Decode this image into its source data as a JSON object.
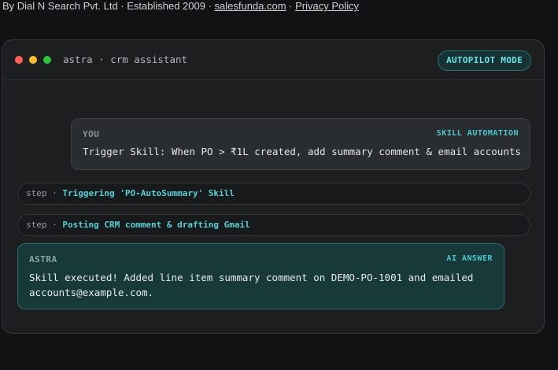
{
  "footer": {
    "prefix": "By Dial N Search Pvt. Ltd · Established 2009 · ",
    "link1": "salesfunda.com",
    "middle": " · ",
    "link2": "Privacy Policy"
  },
  "window": {
    "title": "astra · crm assistant",
    "mode_badge": "AUTOPILOT MODE"
  },
  "messages": {
    "user": {
      "author": "YOU",
      "tag": "SKILL AUTOMATION",
      "text": "Trigger Skill: When PO > ₹1L created, add summary comment & email accounts"
    },
    "steps": [
      {
        "kind": "step",
        "sep": " · ",
        "text": "Triggering 'PO-AutoSummary' Skill"
      },
      {
        "kind": "step",
        "sep": " · ",
        "text": "Posting CRM comment & drafting Gmail"
      }
    ],
    "assistant": {
      "author": "ASTRA",
      "tag": "AI ANSWER",
      "text": "Skill executed! Added line item summary comment on DEMO-PO-1001 and emailed accounts@example.com."
    }
  },
  "colors": {
    "accent": "#58d0d6",
    "window_bg": "#1c1e20",
    "ai_bubble_bg": "#17393a"
  }
}
